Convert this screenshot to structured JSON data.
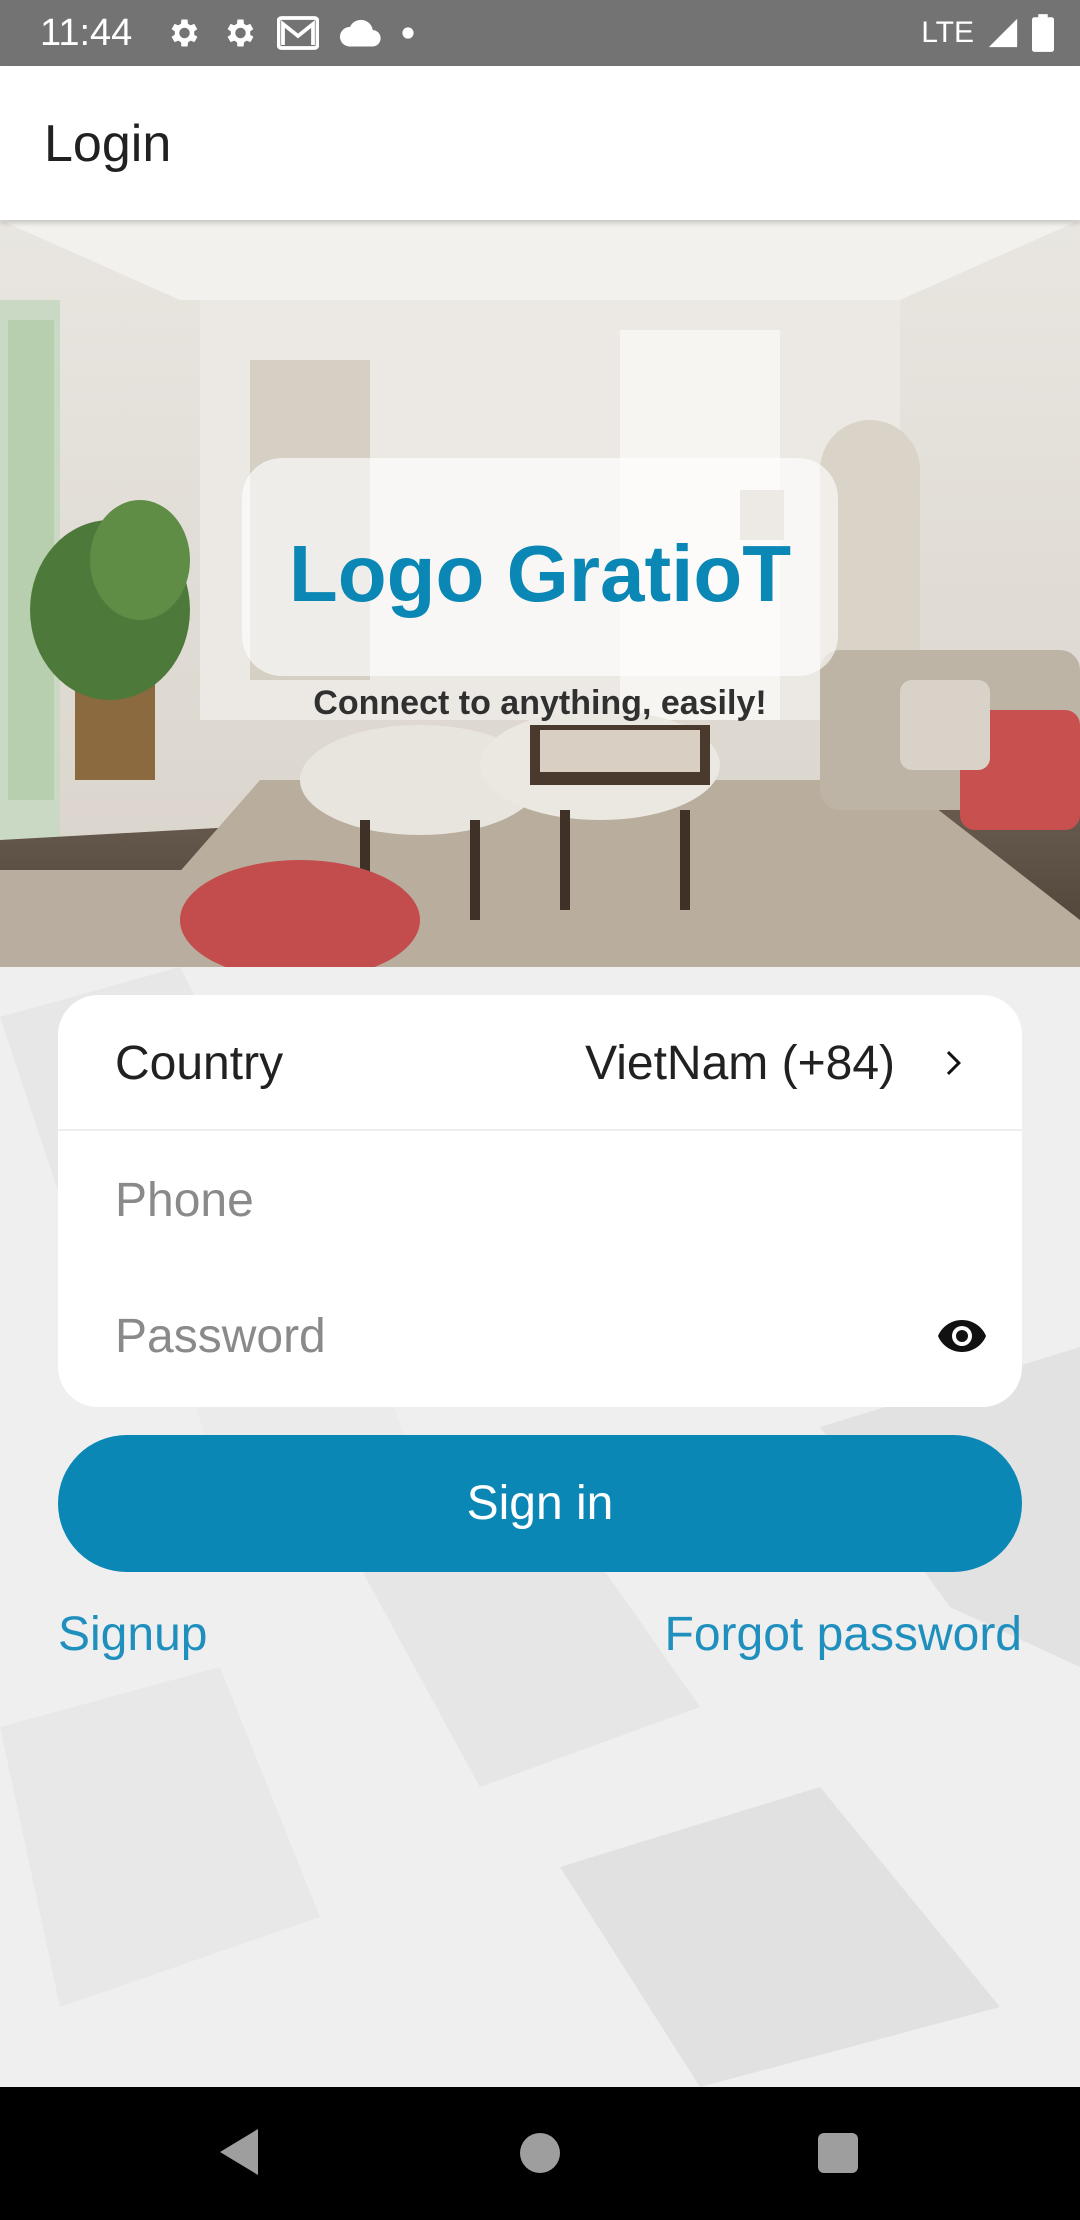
{
  "status_bar": {
    "time": "11:44",
    "network": "LTE",
    "left_icons": [
      "settings-icon",
      "settings-icon",
      "gmail-icon",
      "cloud-icon",
      "dot-icon"
    ],
    "right_icons": [
      "signal-icon",
      "battery-icon"
    ]
  },
  "app_bar": {
    "title": "Login"
  },
  "hero": {
    "logo_text": "Logo GratioT",
    "tagline": "Connect to anything, easily!",
    "image": "living-room-photo"
  },
  "form": {
    "country_label": "Country",
    "country_value": "VietNam (+84)",
    "phone_placeholder": "Phone",
    "phone_value": "",
    "password_placeholder": "Password",
    "password_value": ""
  },
  "actions": {
    "signin_label": "Sign in",
    "signup_label": "Signup",
    "forgot_label": "Forgot password"
  },
  "colors": {
    "accent": "#0a87b5",
    "link": "#1f8fbe",
    "status_bar": "#737373"
  },
  "nav_bar": {
    "buttons": [
      "back-icon",
      "home-icon",
      "recents-icon"
    ]
  }
}
